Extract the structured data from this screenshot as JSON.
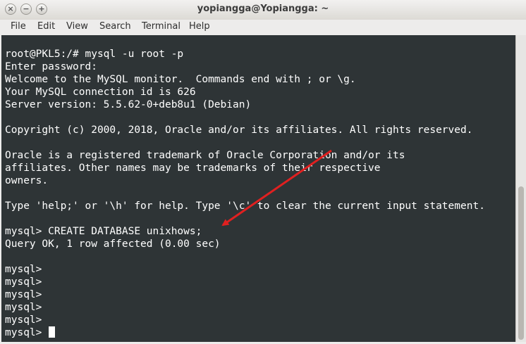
{
  "window": {
    "title": "yopiangga@Yopiangga: ~"
  },
  "titlebar_buttons": [
    {
      "name": "close-button",
      "glyph": "×"
    },
    {
      "name": "minimize-button",
      "glyph": "−"
    },
    {
      "name": "maximize-button",
      "glyph": "+"
    }
  ],
  "menu": [
    "File",
    "Edit",
    "View",
    "Search",
    "Terminal",
    "Help"
  ],
  "terminal": {
    "lines": [
      "root@PKL5:/# mysql -u root -p",
      "Enter password:",
      "Welcome to the MySQL monitor.  Commands end with ; or \\g.",
      "Your MySQL connection id is 626",
      "Server version: 5.5.62-0+deb8u1 (Debian)",
      "",
      "Copyright (c) 2000, 2018, Oracle and/or its affiliates. All rights reserved.",
      "",
      "Oracle is a registered trademark of Oracle Corporation and/or its",
      "affiliates. Other names may be trademarks of their respective",
      "owners.",
      "",
      "Type 'help;' or '\\h' for help. Type '\\c' to clear the current input statement.",
      "",
      "mysql> CREATE DATABASE unixhows;",
      "Query OK, 1 row affected (0.00 sec)",
      "",
      "mysql>",
      "mysql>",
      "mysql>",
      "mysql>",
      "mysql>",
      "mysql> "
    ]
  },
  "colors": {
    "terminal_bg": "#2e3436",
    "terminal_fg": "#ffffff",
    "annotation_arrow": "#e02020"
  }
}
